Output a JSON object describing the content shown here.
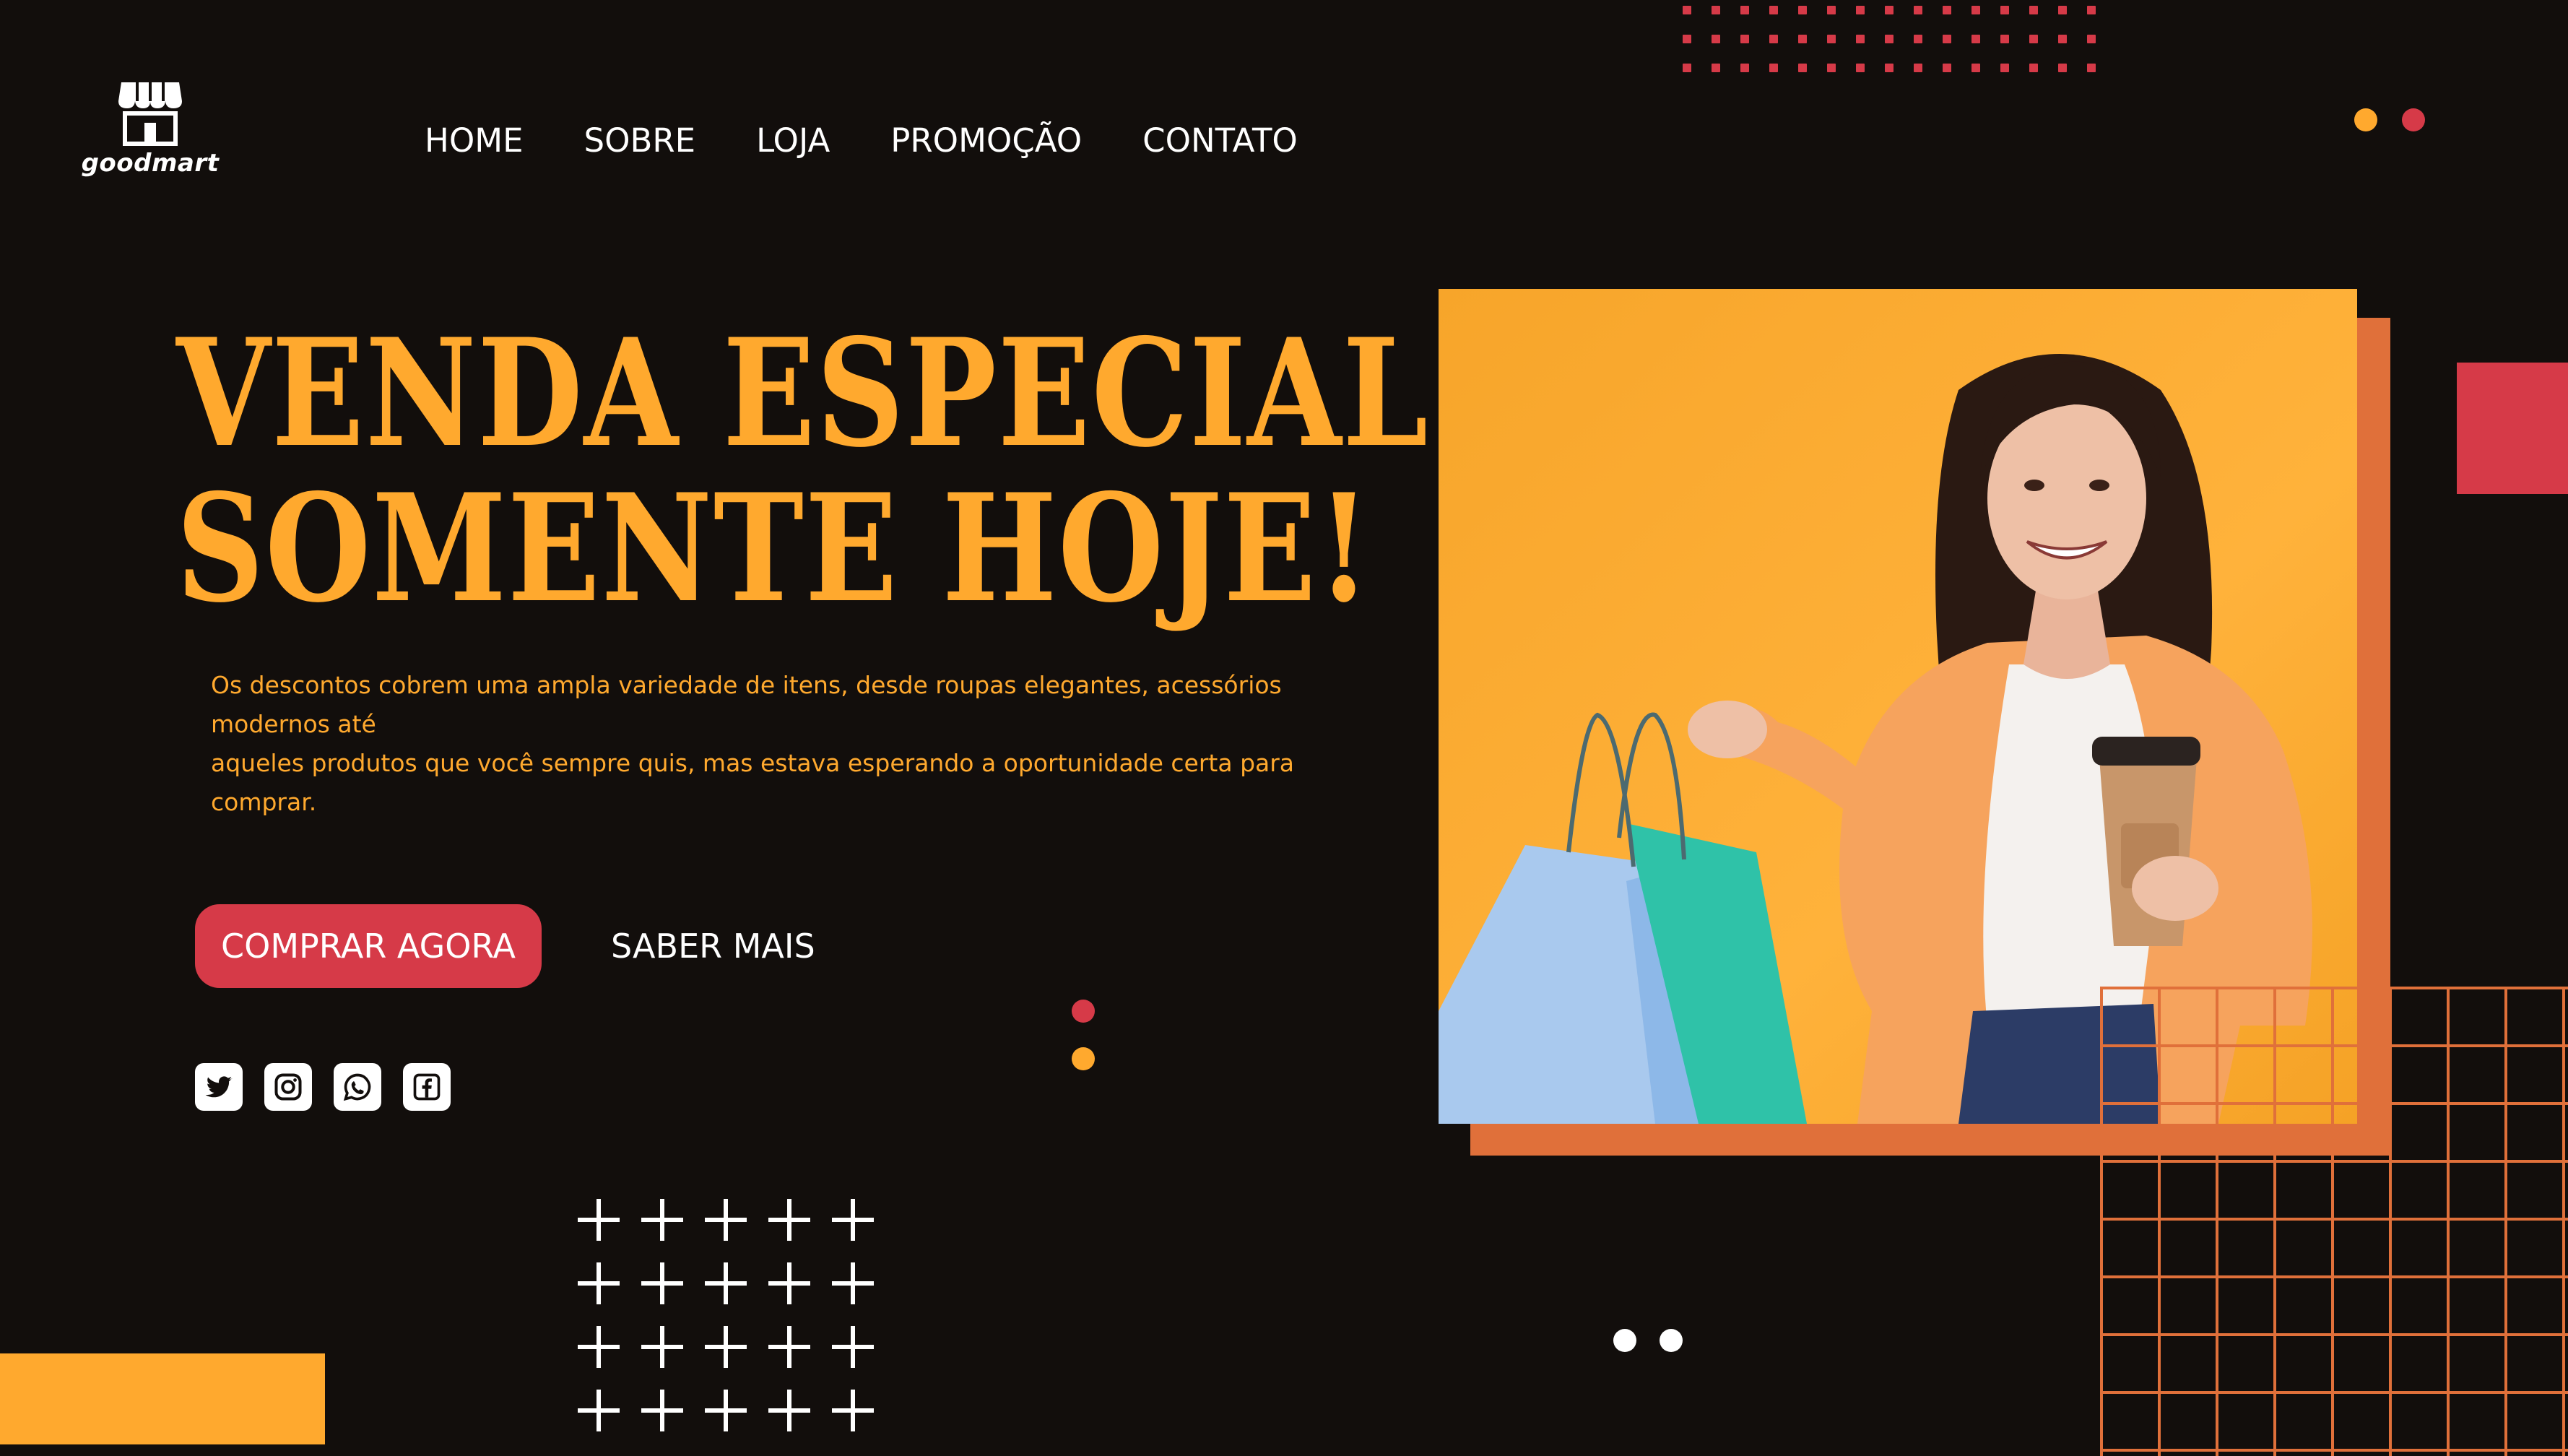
{
  "brand": {
    "name": "goodmart",
    "logo_icon": "storefront-icon"
  },
  "nav": {
    "items": [
      {
        "label": "HOME"
      },
      {
        "label": "SOBRE"
      },
      {
        "label": "LOJA"
      },
      {
        "label": "PROMOÇÃO"
      },
      {
        "label": "CONTATO"
      }
    ]
  },
  "hero": {
    "headline_line1": "VENDA ESPECIAL",
    "headline_line2": "SOMENTE HOJE!",
    "description_line1": "Os descontos cobrem uma ampla variedade de itens, desde roupas elegantes, acessórios modernos até",
    "description_line2": "aqueles produtos que você sempre quis, mas estava esperando a oportunidade certa para comprar.",
    "primary_button": "COMPRAR AGORA",
    "secondary_button": "SABER MAIS",
    "image_alt": "woman-with-shopping-bags-and-coffee"
  },
  "social": [
    {
      "icon": "twitter-icon"
    },
    {
      "icon": "instagram-icon"
    },
    {
      "icon": "whatsapp-icon"
    },
    {
      "icon": "facebook-icon"
    }
  ],
  "colors": {
    "background": "#120e0c",
    "accent_yellow": "#ffa92e",
    "accent_red": "#d63a48",
    "accent_orange": "#e0703a",
    "white": "#ffffff"
  }
}
